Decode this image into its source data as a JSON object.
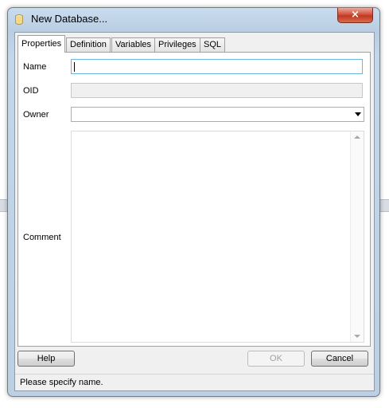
{
  "window": {
    "title": "New Database...",
    "close_glyph": "×"
  },
  "tabs": [
    {
      "label": "Properties",
      "active": true
    },
    {
      "label": "Definition",
      "active": false
    },
    {
      "label": "Variables",
      "active": false
    },
    {
      "label": "Privileges",
      "active": false
    },
    {
      "label": "SQL",
      "active": false
    }
  ],
  "form": {
    "name_label": "Name",
    "name_value": "",
    "oid_label": "OID",
    "oid_value": "",
    "owner_label": "Owner",
    "owner_value": "",
    "comment_label": "Comment",
    "comment_value": ""
  },
  "buttons": {
    "help": "Help",
    "ok": "OK",
    "cancel": "Cancel"
  },
  "status": {
    "message": "Please specify name."
  },
  "colors": {
    "title_bar": "#c4d6ea",
    "close_button": "#c0391f",
    "focus_border": "#6fb6df"
  },
  "icons": {
    "window_icon": "database-icon",
    "close": "close-icon",
    "dropdown": "chevron-down-icon"
  }
}
